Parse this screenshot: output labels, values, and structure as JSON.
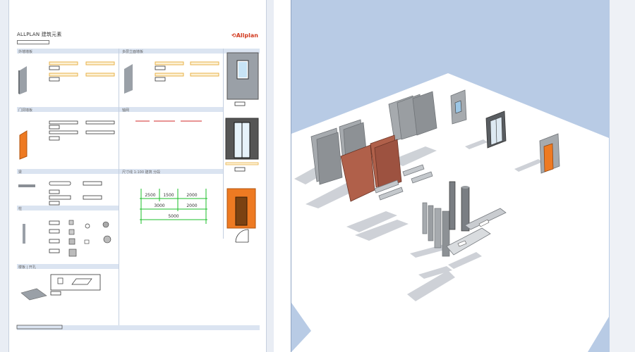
{
  "sheet": {
    "title": "ALLPLAN 建筑元素",
    "logo": "Allplan",
    "sections": {
      "wall": "外墙墙板",
      "wall_layered": "多层立面墙板",
      "door_wall": "门洞墙板",
      "line": "轴网",
      "beam": "梁",
      "dimension": "尺寸线 1:100 建筑 分段",
      "column": "柱",
      "slab": "楼板 | 开孔"
    },
    "dimensions": {
      "row1": [
        "2500",
        "1500",
        "2000"
      ],
      "row2": [
        "3000",
        "2000"
      ],
      "row3": [
        "5000"
      ]
    }
  },
  "colors": {
    "sheet_band": "#dbe4f1",
    "hatch": "#e8b24a",
    "door_orange": "#ee7a22",
    "dim_green": "#1bbf2a",
    "axis_red": "#d22a2a",
    "sky": "#b8cbe5",
    "brick": "#b0604a"
  }
}
